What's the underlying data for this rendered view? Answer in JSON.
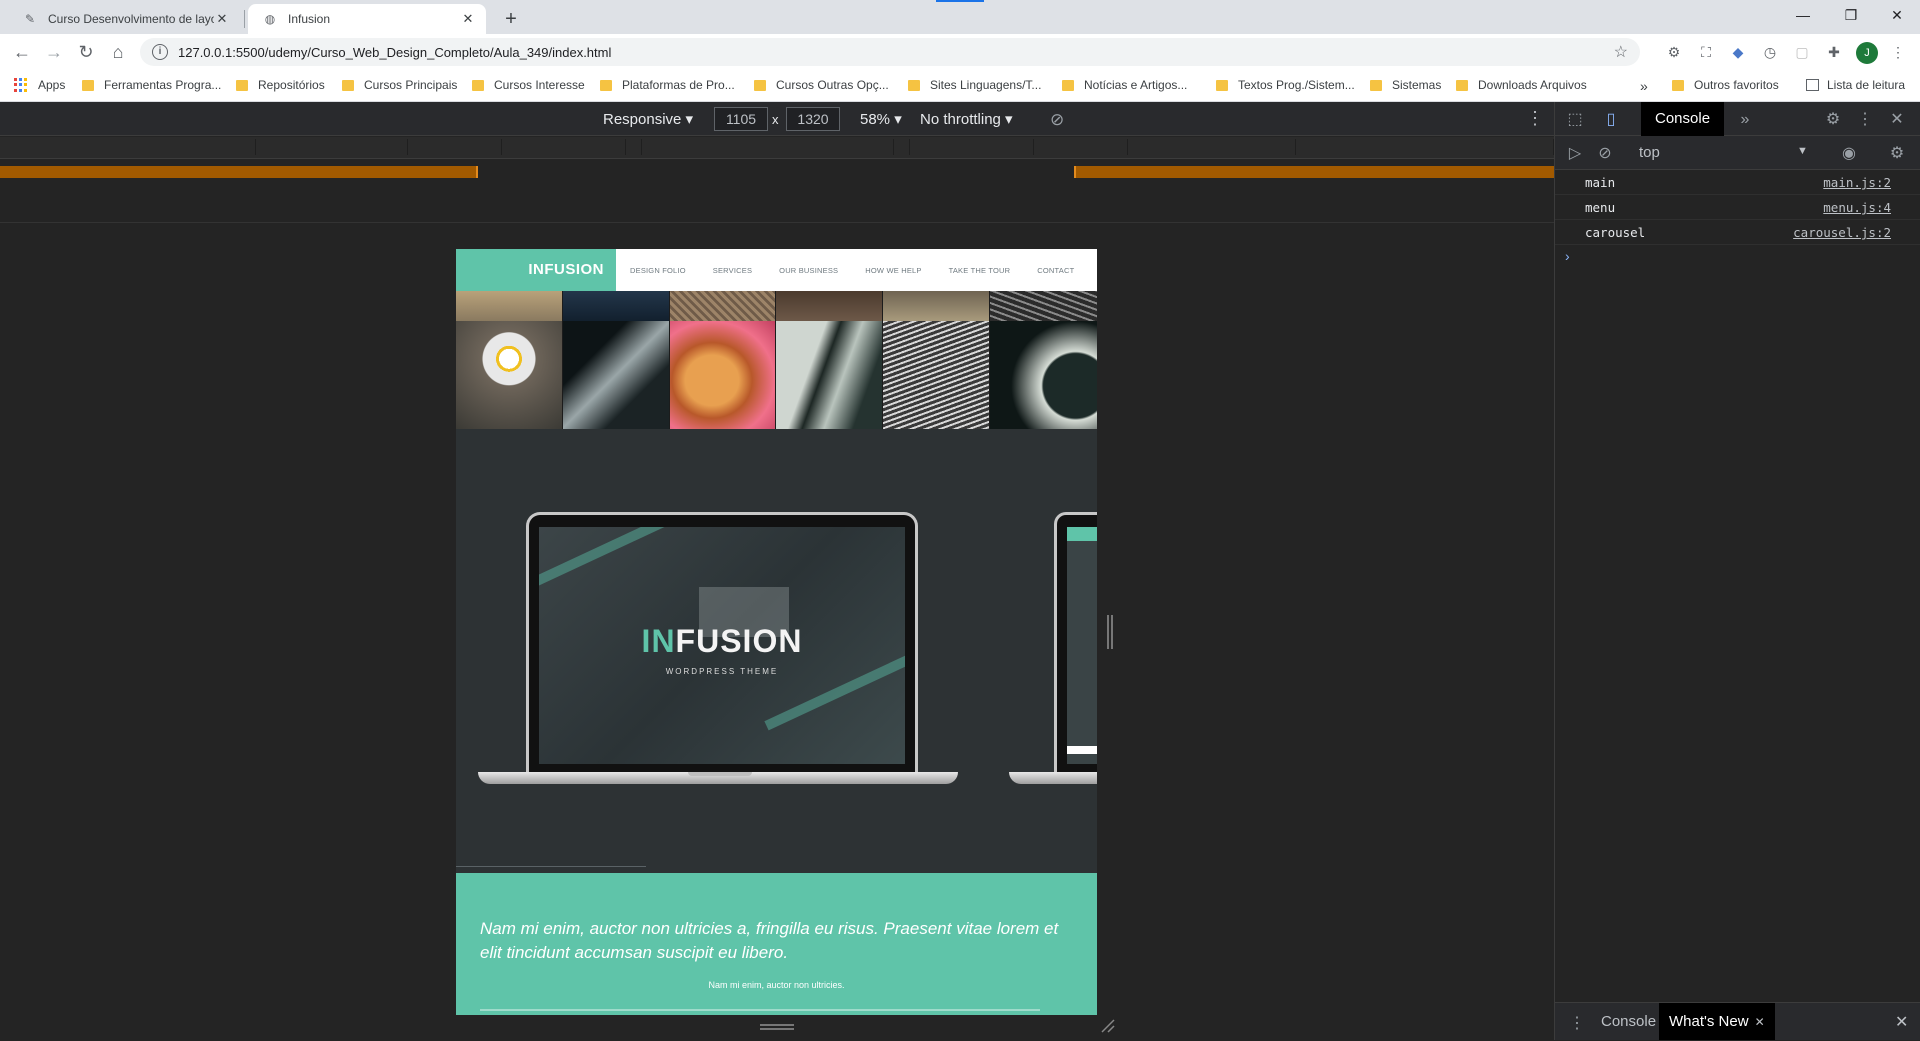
{
  "browser": {
    "tabs": [
      {
        "title": "Curso Desenvolvimento de layou",
        "active": false
      },
      {
        "title": "Infusion",
        "active": true
      }
    ],
    "new_tab": "+",
    "url": "127.0.0.1:5500/udemy/Curso_Web_Design_Completo/Aula_349/index.html",
    "profile_initial": "J"
  },
  "bookmarks": {
    "apps": "Apps",
    "items": [
      "Ferramentas Progra...",
      "Repositórios",
      "Cursos Principais",
      "Cursos Interesse",
      "Plataformas de Pro...",
      "Cursos Outras Opç...",
      "Sites Linguagens/T...",
      "Notícias e Artigos...",
      "Textos Prog./Sistem...",
      "Sistemas",
      "Downloads Arquivos"
    ],
    "overflow": "»",
    "other": "Outros favoritos",
    "reading_list": "Lista de leitura"
  },
  "device_toolbar": {
    "mode": "Responsive",
    "width": "1105",
    "height": "1320",
    "times": "x",
    "zoom": "58%",
    "throttling": "No throttling"
  },
  "site": {
    "logo": "INFUSION",
    "nav": [
      "DESIGN FOLIO",
      "SERVICES",
      "OUR BUSINESS",
      "HOW WE HELP",
      "TAKE THE TOUR",
      "CONTACT"
    ],
    "hero": {
      "brand_accent": "IN",
      "brand_rest": "FUSION",
      "subtitle": "WORDPRESS THEME"
    },
    "quote": {
      "text": "Nam mi enim, auctor non ultricies a, fringilla eu risus. Praesent vitae lorem et elit tincidunt accumsan suscipit eu libero.",
      "cite": "Nam mi enim, auctor non ultricies."
    },
    "accent_color": "#5fc4a9"
  },
  "devtools": {
    "active_tab": "Console",
    "more_tabs": "»",
    "context": "top",
    "logs": [
      {
        "message": "main",
        "source": "main.js:2"
      },
      {
        "message": "menu",
        "source": "menu.js:4"
      },
      {
        "message": "carousel",
        "source": "carousel.js:2"
      }
    ],
    "prompt": "›",
    "drawer_tabs": [
      "Console",
      "What's New"
    ]
  }
}
